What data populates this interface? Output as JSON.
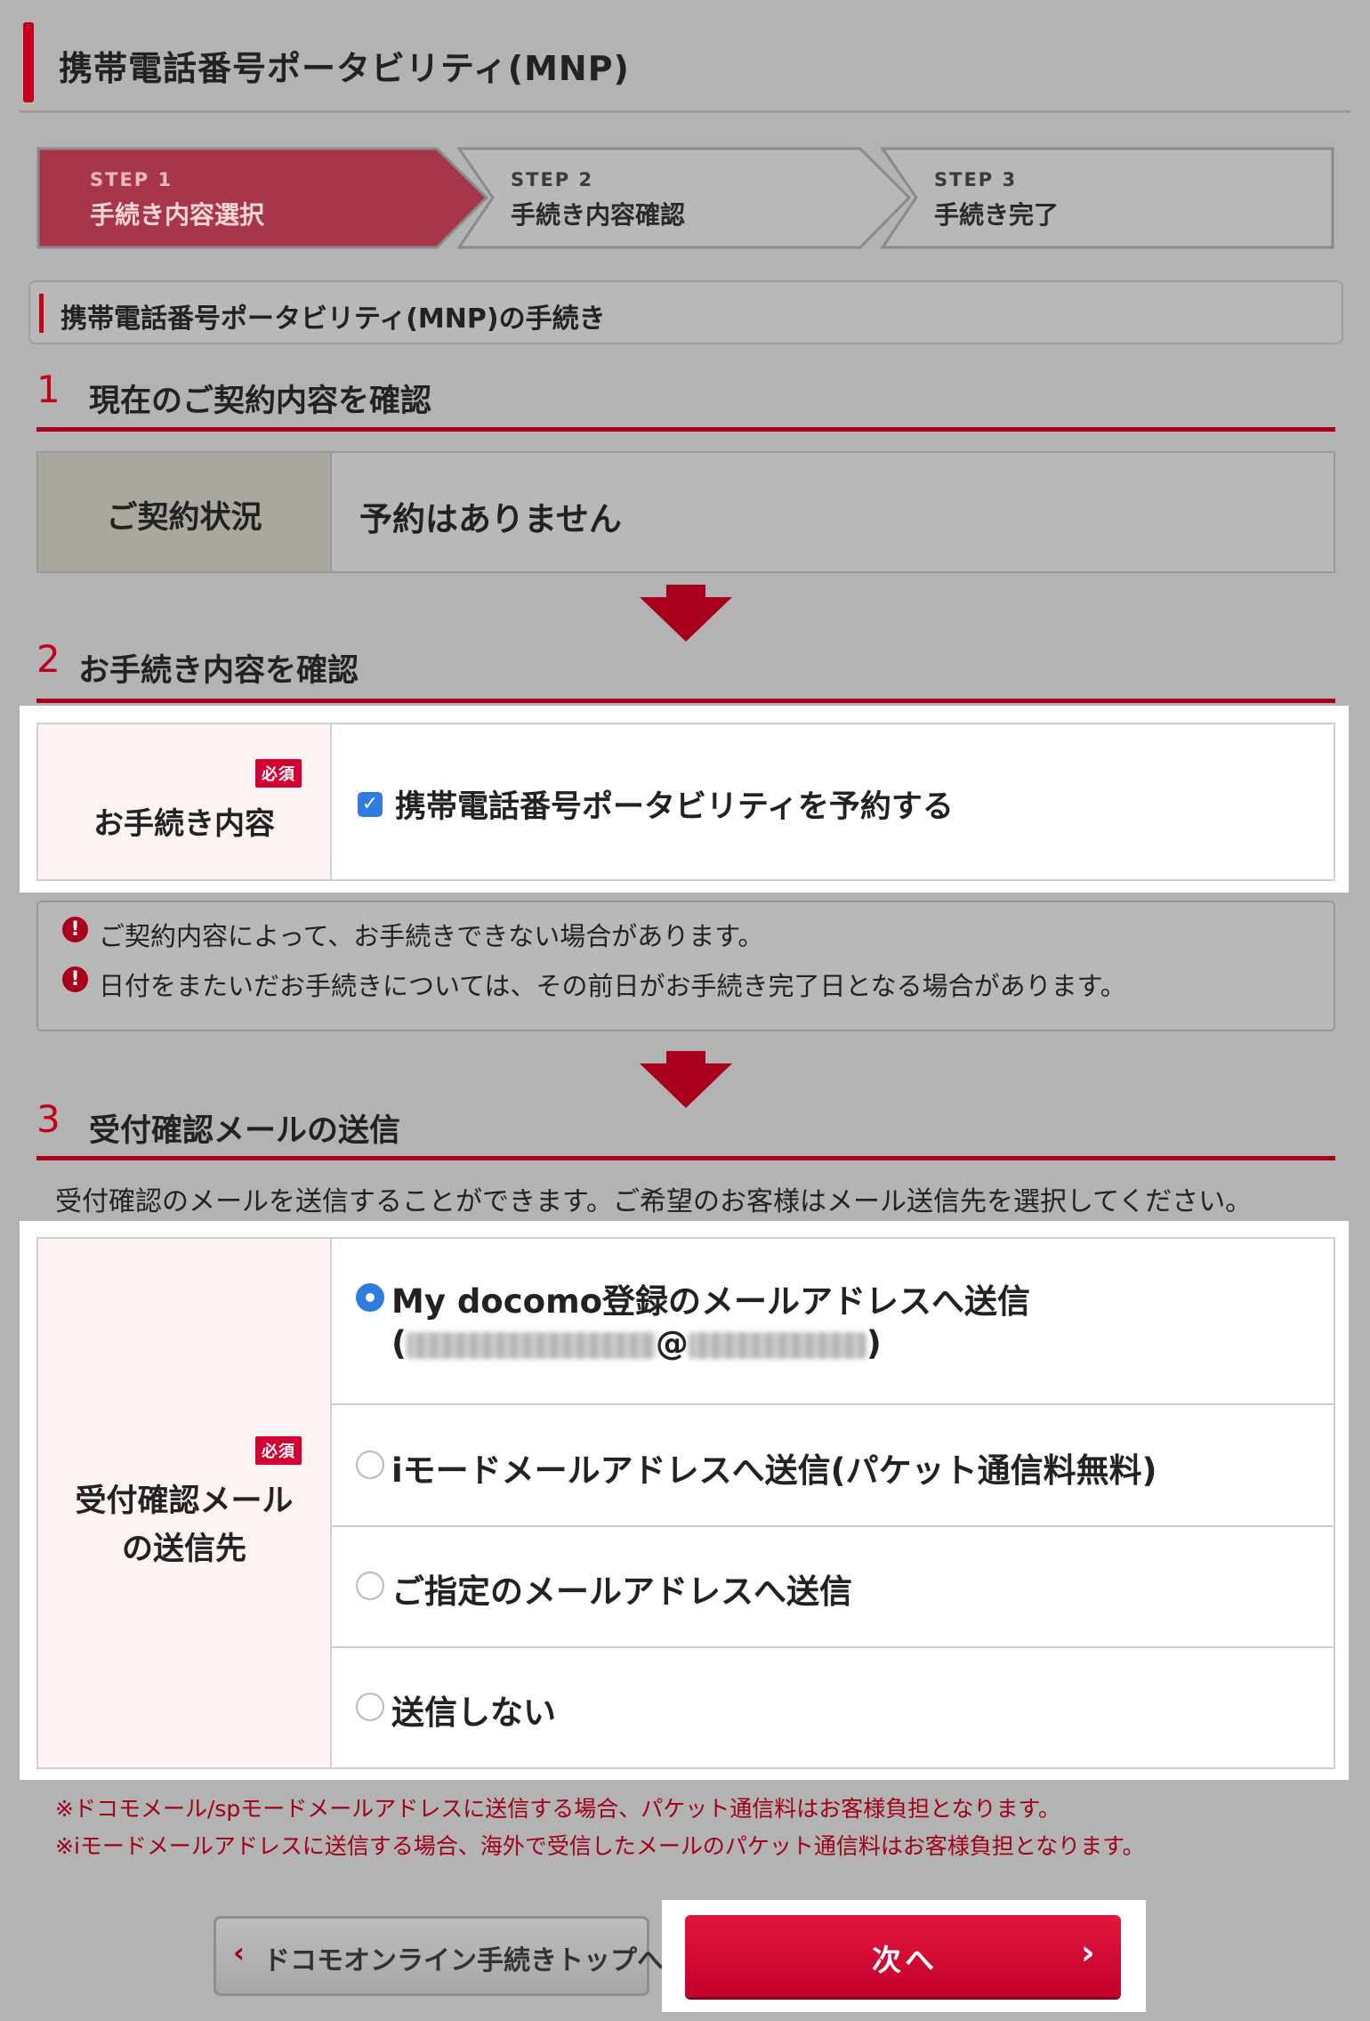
{
  "page": {
    "title": "携帯電話番号ポータビリティ(MNP)",
    "subheading": "携帯電話番号ポータビリティ(MNP)の手続き"
  },
  "steps": [
    {
      "label": "STEP 1",
      "text": "手続き内容選択",
      "active": true
    },
    {
      "label": "STEP 2",
      "text": "手続き内容確認",
      "active": false
    },
    {
      "label": "STEP 3",
      "text": "手続き完了",
      "active": false
    }
  ],
  "section1": {
    "number": "1",
    "title": "現在のご契約内容を確認",
    "label": "ご契約状況",
    "value": "予約はありません"
  },
  "section2": {
    "number": "2",
    "title": "お手続き内容を確認",
    "required_badge": "必須",
    "label": "お手続き内容",
    "checkbox_label": "携帯電話番号ポータビリティを予約する",
    "checkbox_checked": true,
    "notes": [
      "ご契約内容によって、お手続きできない場合があります。",
      "日付をまたいだお手続きについては、その前日がお手続き完了日となる場合があります。"
    ]
  },
  "section3": {
    "number": "3",
    "title": "受付確認メールの送信",
    "intro": "受付確認のメールを送信することができます。ご希望のお客様はメール送信先を選択してください。",
    "required_badge": "必須",
    "label_line1": "受付確認メール",
    "label_line2": "の送信先",
    "options": [
      {
        "text": "My docomo登録のメールアドレスへ送信",
        "sub_prefix": "(",
        "sub_at": "@",
        "sub_suffix": ")",
        "checked": true
      },
      {
        "text": "iモードメールアドレスへ送信(パケット通信料無料)",
        "checked": false
      },
      {
        "text": "ご指定のメールアドレスへ送信",
        "checked": false
      },
      {
        "text": "送信しない",
        "checked": false
      }
    ],
    "footnotes": [
      "※ドコモメール/spモードメールアドレスに送信する場合、パケット通信料はお客様負担となります。",
      "※iモードメールアドレスに送信する場合、海外で受信したメールのパケット通信料はお客様負担となります。"
    ]
  },
  "buttons": {
    "back": "ドコモオンライン手続きトップへ",
    "next": "次へ"
  },
  "colors": {
    "accent": "#c4001b",
    "required_badge": "#d50032",
    "checkbox": "#2f7bde",
    "page_bg": "#b3b3b3"
  }
}
